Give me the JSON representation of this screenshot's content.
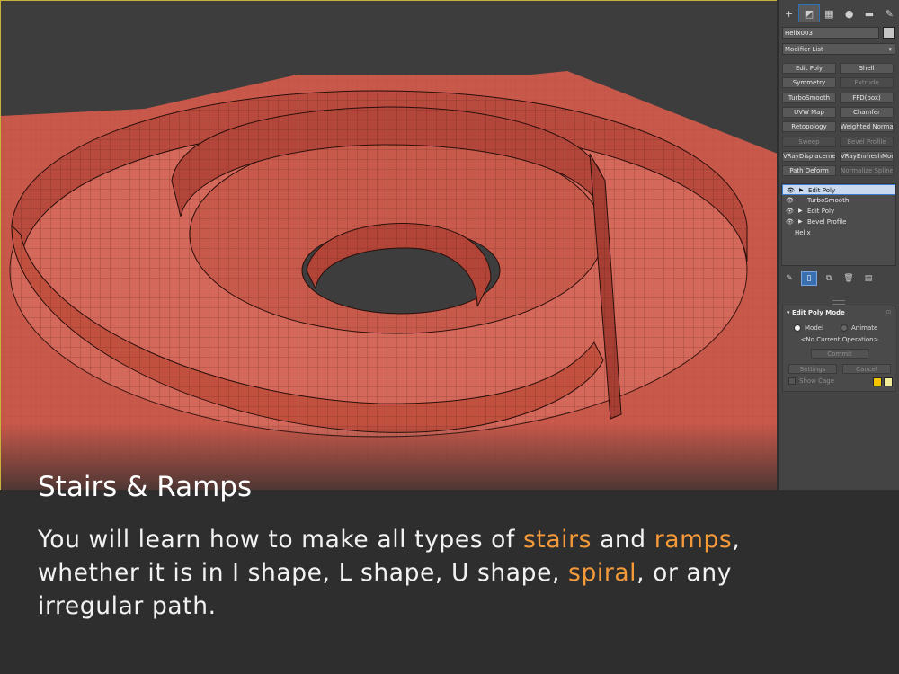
{
  "panel": {
    "tabs": [
      {
        "icon": "create-icon",
        "glyph": "+"
      },
      {
        "icon": "modify-icon",
        "glyph": "◩"
      },
      {
        "icon": "hierarchy-icon",
        "glyph": "▦"
      },
      {
        "icon": "motion-icon",
        "glyph": "●"
      },
      {
        "icon": "display-icon",
        "glyph": "▬"
      },
      {
        "icon": "utilities-icon",
        "glyph": "✎"
      }
    ],
    "object_name": "Helix003",
    "modifier_list": "Modifier List",
    "modifier_buttons": [
      {
        "label": "Edit Poly",
        "enabled": true
      },
      {
        "label": "Shell",
        "enabled": true
      },
      {
        "label": "Symmetry",
        "enabled": true
      },
      {
        "label": "Extrude",
        "enabled": false
      },
      {
        "label": "TurboSmooth",
        "enabled": true
      },
      {
        "label": "FFD(box)",
        "enabled": true
      },
      {
        "label": "UVW Map",
        "enabled": true
      },
      {
        "label": "Chamfer",
        "enabled": true
      },
      {
        "label": "Retopology",
        "enabled": true
      },
      {
        "label": "Weighted Normals",
        "enabled": true
      },
      {
        "label": "Sweep",
        "enabled": false
      },
      {
        "label": "Bevel Profile",
        "enabled": false
      },
      {
        "label": "VRayDisplacementMod",
        "enabled": true
      },
      {
        "label": "VRayEnmeshMod",
        "enabled": true
      },
      {
        "label": "Path Deform",
        "enabled": true
      },
      {
        "label": "Normalize Spline",
        "enabled": false
      }
    ],
    "stack": [
      {
        "label": "Edit Poly",
        "selected": true,
        "expandable": true
      },
      {
        "label": "TurboSmooth",
        "selected": false,
        "expandable": false
      },
      {
        "label": "Edit Poly",
        "selected": false,
        "expandable": true
      },
      {
        "label": "Bevel Profile",
        "selected": false,
        "expandable": true
      }
    ],
    "stack_base": "Helix",
    "rollout": {
      "title": "Edit Poly Mode",
      "model_label": "Model",
      "animate_label": "Animate",
      "status": "<No Current Operation>",
      "commit_label": "Commit",
      "settings_label": "Settings",
      "cancel_label": "Cancel",
      "show_cage_label": "Show Cage",
      "cage_colors": [
        "#f5c400",
        "#f0ec9a"
      ]
    }
  },
  "caption": {
    "title": "Stairs & Ramps",
    "body": {
      "p1": "You will learn how to make all types of ",
      "h1": "stairs",
      "p2": " and ",
      "h2": "ramps",
      "p3": ",",
      "p4": "whether it is in I shape, L shape, U shape, ",
      "h3": "spiral",
      "p5": ", or any",
      "p6": "irregular path."
    },
    "highlight_color": "#f49a3a"
  }
}
